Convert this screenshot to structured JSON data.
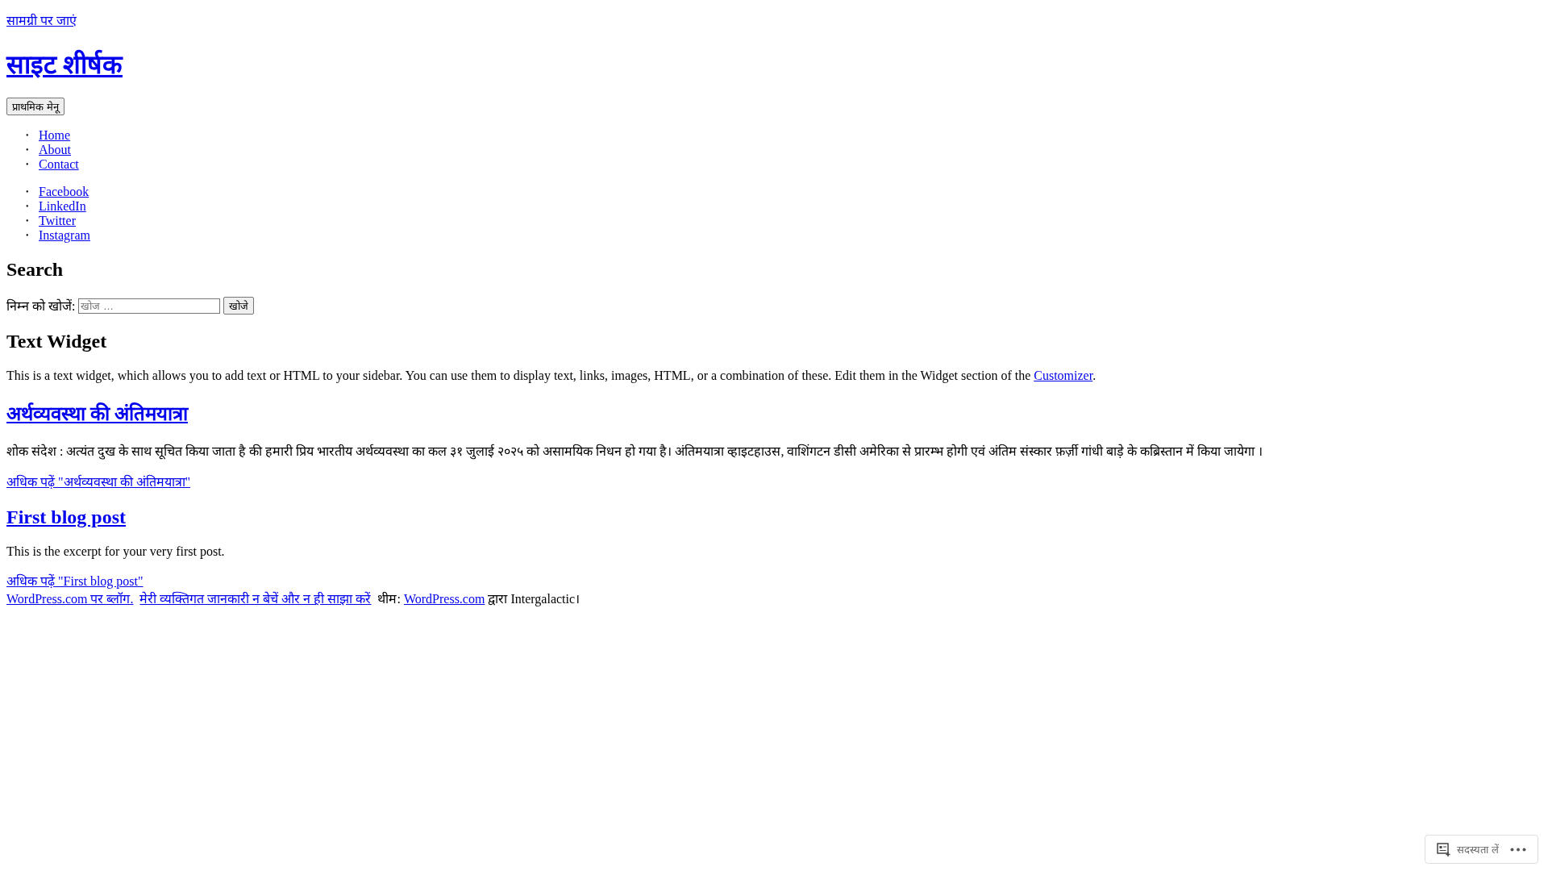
{
  "skip_link": "सामग्री पर जाएं",
  "site_title": "साइट शीर्षक",
  "menu_button": "प्राथमिक मेनू",
  "list_marker": "•",
  "nav_menu": [
    "Home",
    "About",
    "Contact"
  ],
  "social_menu": [
    "Facebook",
    "LinkedIn",
    "Twitter",
    "Instagram"
  ],
  "widgets": [
    {
      "kind": "search",
      "title": "Search",
      "label": "निम्न को खोजें:",
      "placeholder": "खोज …",
      "button": "खोजे"
    },
    {
      "kind": "text",
      "title": "Text Widget",
      "text": "This is a text widget, which allows you to add text or HTML to your sidebar. You can use them to display text, links, images, HTML, or a combination of these. Edit them in the Widget section of the",
      "link": "Customizer",
      "after": "."
    }
  ],
  "posts": [
    {
      "title": "अर्थव्यवस्था की अंतिमयात्रा",
      "excerpt": "शोक संदेश : अत्यंत दुख के साथ सूचित किया जाता है की हमारी प्रिय भारतीय अर्थव्यवस्था का कल ३१ जुलाई २०२५ को असामयिक निधन हो गया है। अंतिमयात्रा व्हाइटहाउस, वाशिंगटन डीसी अमेरिका से प्रारम्भ होगी एवं अंतिम संस्कार फ़र्ज़ी गांधी बाड़े के कब्रिस्तान में किया जायेगा ।",
      "more_link": "अधिक पढ़ें \"अर्थव्यवस्था की अंतिमयात्रा\""
    },
    {
      "title": "First blog post",
      "excerpt": "This is the excerpt for your very first post.",
      "more_link": "अधिक पढ़ें \"First blog post\""
    }
  ],
  "footer": {
    "blog_link": "WordPress.com पर ब्लॉग.",
    "privacy_link": "मेरी व्यक्तिगत जानकारी न बेचें और न ही साझा करें",
    "theme_label": "थीम:",
    "theme_link": "WordPress.com",
    "theme_by": "द्वारा Intergalactic।"
  },
  "subscribe": {
    "label": "सदस्यता लें"
  }
}
